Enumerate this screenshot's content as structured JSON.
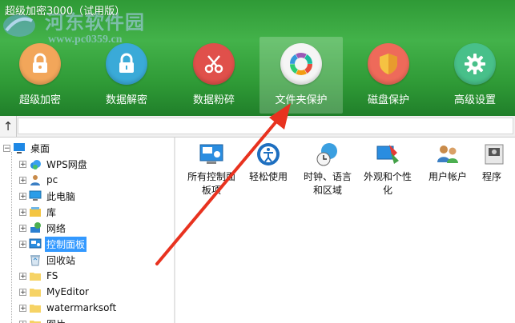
{
  "title": "超级加密3000（试用版）",
  "watermark": {
    "text": "河东软件园",
    "url": "www.pc0359.cn"
  },
  "toolbar": [
    {
      "label": "超级加密",
      "icon": "lock-icon",
      "color": "#f2a65a"
    },
    {
      "label": "数据解密",
      "icon": "unlock-icon",
      "color": "#3aaad8"
    },
    {
      "label": "数据粉碎",
      "icon": "scissors-icon",
      "color": "#e0504b"
    },
    {
      "label": "文件夹保护",
      "icon": "folder-protect-icon",
      "color": "#f5f5f5"
    },
    {
      "label": "磁盘保护",
      "icon": "shield-icon",
      "color": "#ee6a5a"
    },
    {
      "label": "高级设置",
      "icon": "gear-icon",
      "color": "#48c08a"
    }
  ],
  "nav": {
    "up": "↑"
  },
  "tree": [
    {
      "label": "桌面",
      "icon": "desktop-icon"
    },
    {
      "label": "WPS网盘",
      "icon": "cloud-icon"
    },
    {
      "label": "pc",
      "icon": "user-icon"
    },
    {
      "label": "此电脑",
      "icon": "computer-icon"
    },
    {
      "label": "库",
      "icon": "library-icon"
    },
    {
      "label": "网络",
      "icon": "network-icon"
    },
    {
      "label": "控制面板",
      "icon": "control-panel-icon"
    },
    {
      "label": "回收站",
      "icon": "recycle-bin-icon"
    },
    {
      "label": "FS",
      "icon": "folder-icon"
    },
    {
      "label": "MyEditor",
      "icon": "folder-icon"
    },
    {
      "label": "watermarksoft",
      "icon": "folder-icon"
    },
    {
      "label": "图片",
      "icon": "folder-icon"
    }
  ],
  "content_items": [
    {
      "line1": "所有控制面",
      "line2": "板项",
      "icon": "control-panel-icon"
    },
    {
      "line1": "轻松使用",
      "line2": "",
      "icon": "ease-of-access-icon"
    },
    {
      "line1": "时钟、语言",
      "line2": "和区域",
      "icon": "clock-globe-icon"
    },
    {
      "line1": "外观和个性",
      "line2": "化",
      "icon": "appearance-icon"
    },
    {
      "line1": "用户帐户",
      "line2": "",
      "icon": "users-icon"
    },
    {
      "line1": "程序",
      "line2": "",
      "icon": "programs-icon"
    }
  ]
}
